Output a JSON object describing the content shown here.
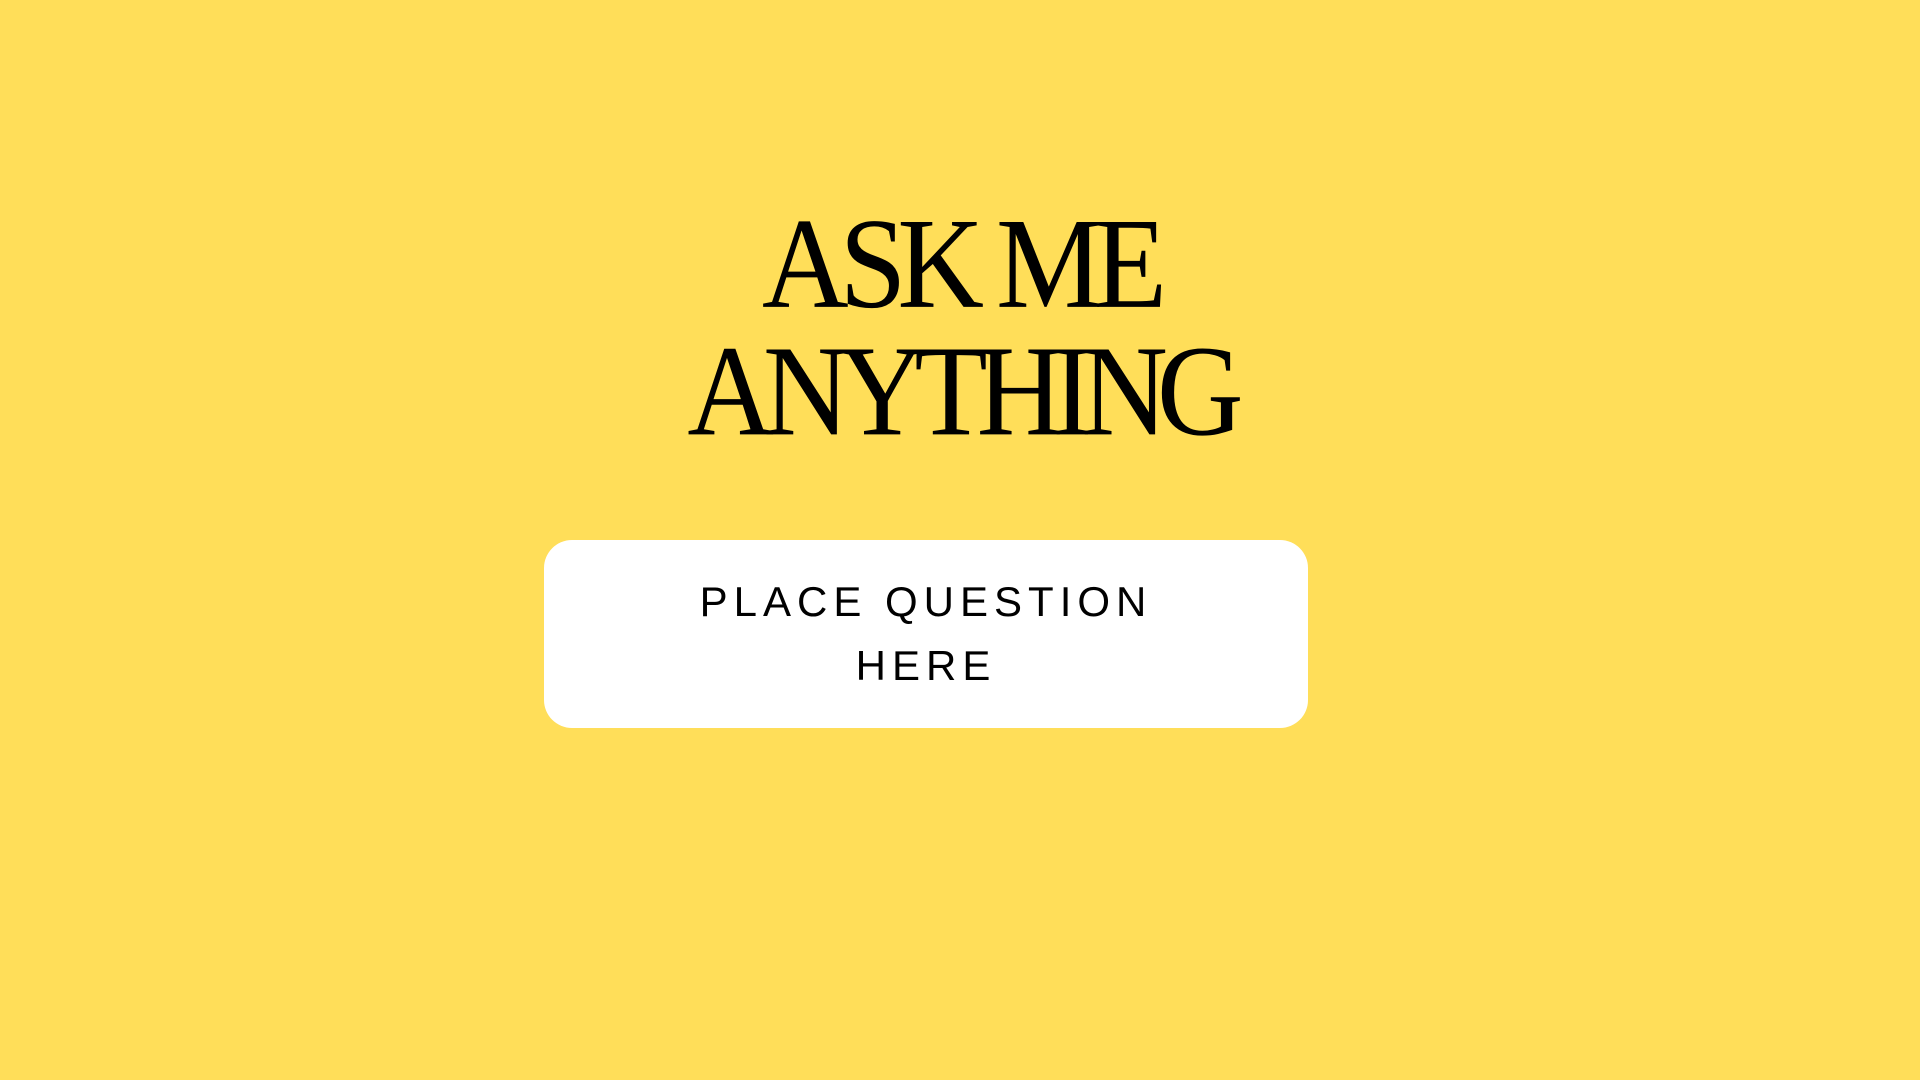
{
  "headline": {
    "line1": "ASK ME",
    "line2": "ANYTHING"
  },
  "question_card": {
    "text": "PLACE QUESTION HERE"
  },
  "colors": {
    "background": "#FFDE59",
    "card": "#FFFFFF",
    "text": "#000000"
  }
}
